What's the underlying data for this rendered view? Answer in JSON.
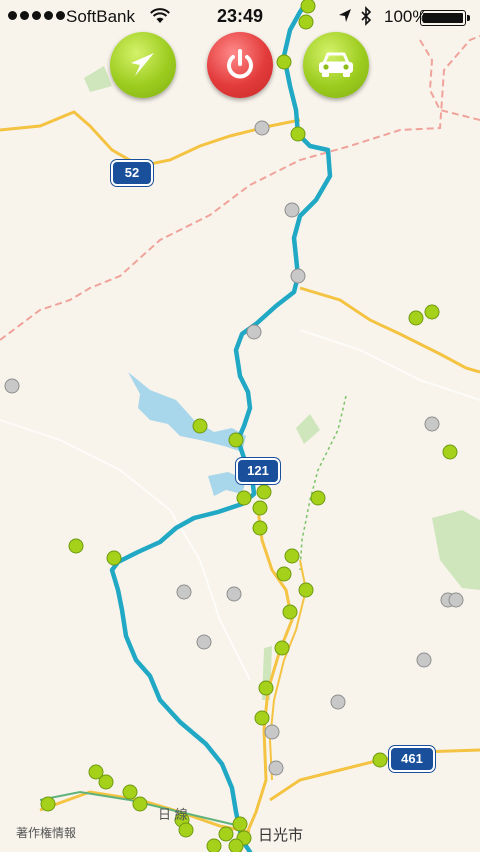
{
  "status_bar": {
    "carrier": "SoftBank",
    "time": "23:49",
    "battery_percent": "100%",
    "icons": [
      "signal-dots",
      "wifi-icon",
      "location-arrow-icon",
      "bluetooth-icon",
      "battery-icon"
    ]
  },
  "controls": {
    "navigate_button": {
      "icon": "navigation-arrow-icon",
      "color": "#9dcc1f"
    },
    "power_button": {
      "icon": "power-icon",
      "color": "#e33b3b"
    },
    "car_button": {
      "icon": "car-icon",
      "color": "#9dcc1f"
    }
  },
  "map": {
    "route_shields": [
      "52",
      "121",
      "461"
    ],
    "labels": {
      "city": "日光市",
      "rail": "日  線",
      "attribution": "著作権情報"
    },
    "colors": {
      "background": "#f8f4ec",
      "route": "#20a8c4",
      "road": "#f5c342",
      "border": "#f0a39a",
      "water": "#a8d6ea",
      "park": "#cfe6bd",
      "marker_green": "#a6d11b",
      "marker_gray": "#c8c8c8"
    }
  }
}
